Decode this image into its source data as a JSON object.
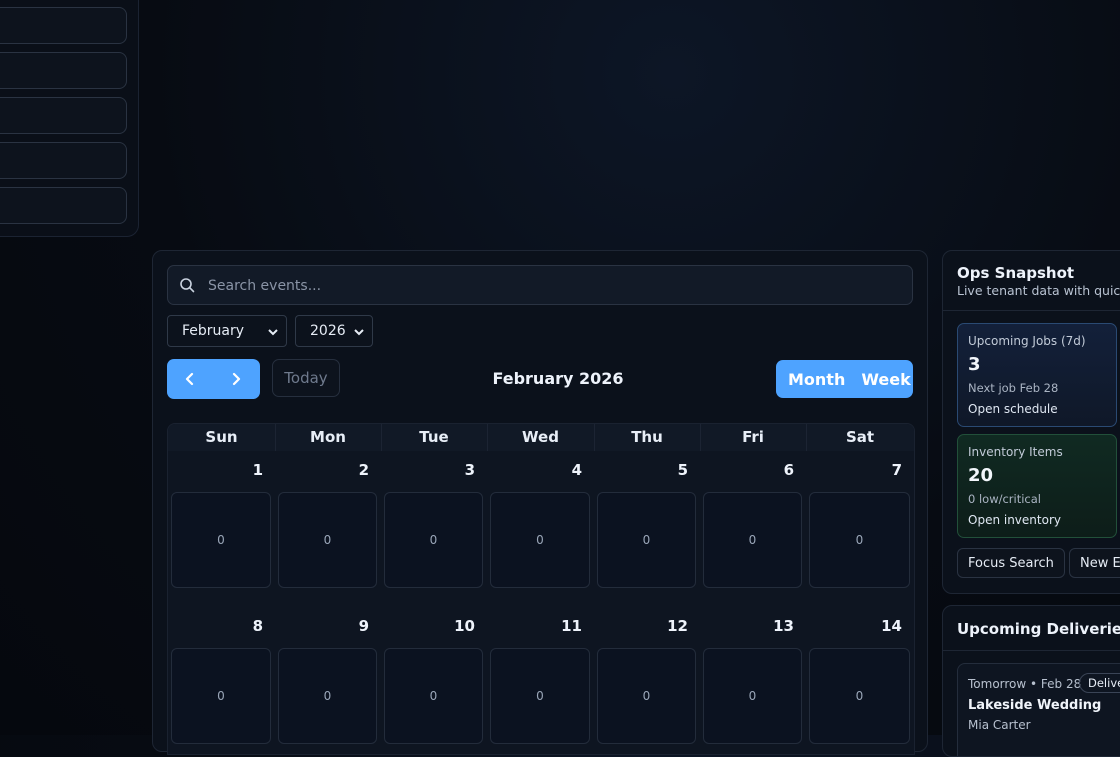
{
  "search": {
    "placeholder": "Search events..."
  },
  "month_select": {
    "value": "February"
  },
  "year_select": {
    "value": "2026"
  },
  "toolbar": {
    "today_label": "Today",
    "title": "February 2026",
    "month_label": "Month",
    "week_label": "Week"
  },
  "weekdays": [
    "Sun",
    "Mon",
    "Tue",
    "Wed",
    "Thu",
    "Fri",
    "Sat"
  ],
  "weeks": [
    [
      {
        "day": "1",
        "count": "0"
      },
      {
        "day": "2",
        "count": "0"
      },
      {
        "day": "3",
        "count": "0"
      },
      {
        "day": "4",
        "count": "0"
      },
      {
        "day": "5",
        "count": "0"
      },
      {
        "day": "6",
        "count": "0"
      },
      {
        "day": "7",
        "count": "0"
      }
    ],
    [
      {
        "day": "8",
        "count": "0"
      },
      {
        "day": "9",
        "count": "0"
      },
      {
        "day": "10",
        "count": "0"
      },
      {
        "day": "11",
        "count": "0"
      },
      {
        "day": "12",
        "count": "0"
      },
      {
        "day": "13",
        "count": "0"
      },
      {
        "day": "14",
        "count": "0"
      }
    ]
  ],
  "ops": {
    "title": "Ops Snapshot",
    "subtitle": "Live tenant data with quick",
    "upcoming": {
      "label": "Upcoming Jobs (7d)",
      "value": "3",
      "meta": "Next job Feb 28",
      "link": "Open schedule"
    },
    "inventory": {
      "label": "Inventory Items",
      "value": "20",
      "meta": "0 low/critical",
      "link": "Open inventory"
    },
    "focus_label": "Focus Search",
    "new_label": "New Ev"
  },
  "deliveries": {
    "title": "Upcoming Deliveries &",
    "item": {
      "when": "Tomorrow • Feb 28",
      "badge": "Delive",
      "name": "Lakeside Wedding",
      "client": "Mia Carter"
    }
  },
  "colors": {
    "accent": "#4ea3ff",
    "background": "#070b12",
    "card": "#0b111b"
  }
}
